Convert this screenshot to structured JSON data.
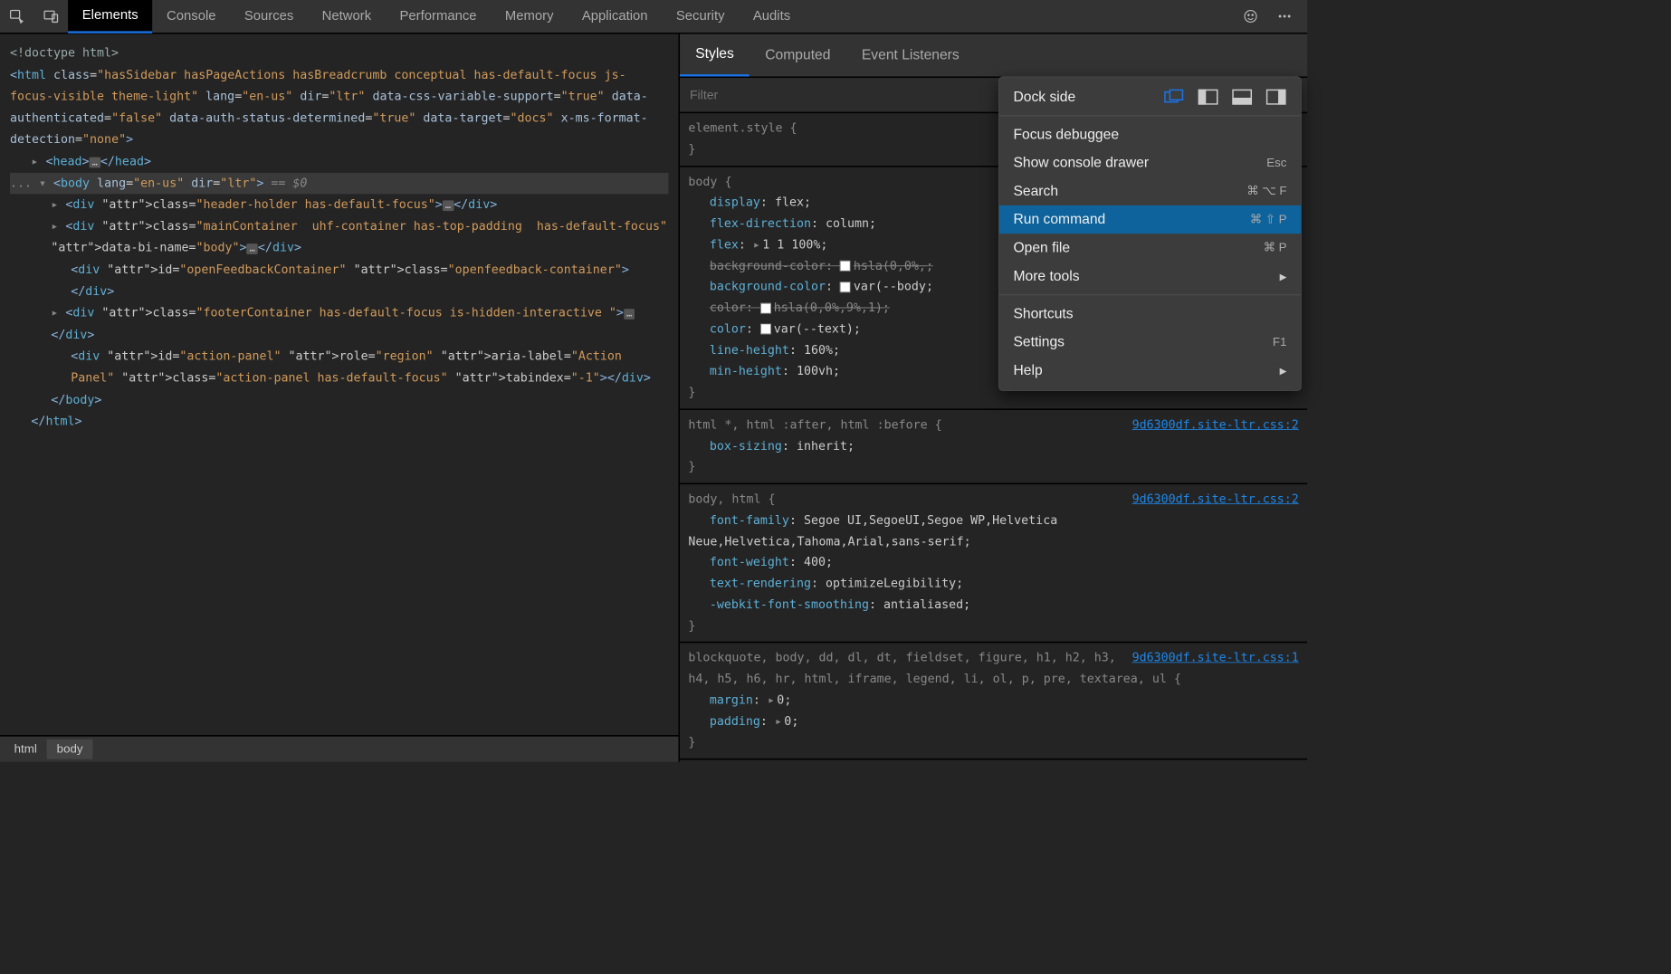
{
  "topbar": {
    "tabs": [
      "Elements",
      "Console",
      "Sources",
      "Network",
      "Performance",
      "Memory",
      "Application",
      "Security",
      "Audits"
    ],
    "active_index": 0
  },
  "dom": {
    "doctype": "<!doctype html>",
    "html_open": {
      "classes": "hasSidebar hasPageActions hasBreadcrumb conceptual has-default-focus js-focus-visible theme-light",
      "lang": "en-us",
      "dir": "ltr",
      "extra": "data-css-variable-support=\"true\" data-authenticated=\"false\" data-auth-status-determined=\"true\" data-target=\"docs\" x-ms-format-detection=\"none\""
    },
    "body_open": {
      "lang": "en-us",
      "dir": "ltr",
      "selected_marker": "== $0"
    },
    "children": [
      {
        "tag": "div",
        "attrs": "class=\"header-holder has-default-focus\"",
        "folded": true
      },
      {
        "tag": "div",
        "attrs": "class=\"mainContainer  uhf-container has-top-padding  has-default-focus\" data-bi-name=\"body\"",
        "folded": true
      },
      {
        "tag": "div",
        "attrs": "id=\"openFeedbackContainer\" class=\"openfeedback-container\"",
        "expand": true
      },
      {
        "tag": "div",
        "attrs": "class=\"footerContainer has-default-focus is-hidden-interactive \"",
        "folded": true
      },
      {
        "tag": "div",
        "attrs": "id=\"action-panel\" role=\"region\" aria-label=\"Action Panel\" class=\"action-panel has-default-focus\" tabindex=\"-1\"",
        "expand": true
      }
    ],
    "breadcrumb": [
      "html",
      "body"
    ],
    "breadcrumb_active": 1
  },
  "styles": {
    "subtabs": [
      "Styles",
      "Computed",
      "Event Listeners"
    ],
    "subtab_active": 0,
    "filter_placeholder": "Filter",
    "rules": [
      {
        "selector": "element.style",
        "source": "",
        "props": []
      },
      {
        "selector": "body",
        "source": "",
        "props": [
          {
            "name": "display",
            "value": "flex"
          },
          {
            "name": "flex-direction",
            "value": "column"
          },
          {
            "name": "flex",
            "value": "1 1 100%",
            "tri": true
          },
          {
            "name": "background-color",
            "value": "hsla(0,0%,",
            "swatch": true,
            "strike": true
          },
          {
            "name": "background-color",
            "value": "var(--body",
            "swatch": true
          },
          {
            "name": "color",
            "value": "hsla(0,0%,9%,1)",
            "swatch": true,
            "strike": true
          },
          {
            "name": "color",
            "value": "var(--text)",
            "swatch": true
          },
          {
            "name": "line-height",
            "value": "160%"
          },
          {
            "name": "min-height",
            "value": "100vh"
          }
        ]
      },
      {
        "selector": "html *, html :after, html :before",
        "source": "9d6300df.site-ltr.css:2",
        "props": [
          {
            "name": "box-sizing",
            "value": "inherit"
          }
        ]
      },
      {
        "selector": "body, html",
        "source": "9d6300df.site-ltr.css:2",
        "props": [
          {
            "name": "font-family",
            "value": "Segoe UI,SegoeUI,Segoe WP,Helvetica Neue,Helvetica,Tahoma,Arial,sans-serif"
          },
          {
            "name": "font-weight",
            "value": "400"
          },
          {
            "name": "text-rendering",
            "value": "optimizeLegibility"
          },
          {
            "name": "-webkit-font-smoothing",
            "value": "antialiased"
          }
        ]
      },
      {
        "selector": "blockquote, body, dd, dl, dt, fieldset, figure, h1, h2, h3, h4, h5, h6, hr, html, iframe, legend, li, ol, p, pre, textarea, ul",
        "source": "9d6300df.site-ltr.css:1",
        "props": [
          {
            "name": "margin",
            "value": "0",
            "tri": true
          },
          {
            "name": "padding",
            "value": "0",
            "tri": true
          }
        ]
      }
    ]
  },
  "context_menu": {
    "dock_label": "Dock side",
    "items1": [
      {
        "label": "Focus debuggee"
      },
      {
        "label": "Show console drawer",
        "shortcut": "Esc"
      },
      {
        "label": "Search",
        "shortcut": "⌘ ⌥ F"
      },
      {
        "label": "Run command",
        "shortcut": "⌘ ⇧ P",
        "highlight": true
      },
      {
        "label": "Open file",
        "shortcut": "⌘ P"
      },
      {
        "label": "More tools",
        "submenu": true
      }
    ],
    "items2": [
      {
        "label": "Shortcuts"
      },
      {
        "label": "Settings",
        "shortcut": "F1"
      },
      {
        "label": "Help",
        "submenu": true
      }
    ]
  }
}
